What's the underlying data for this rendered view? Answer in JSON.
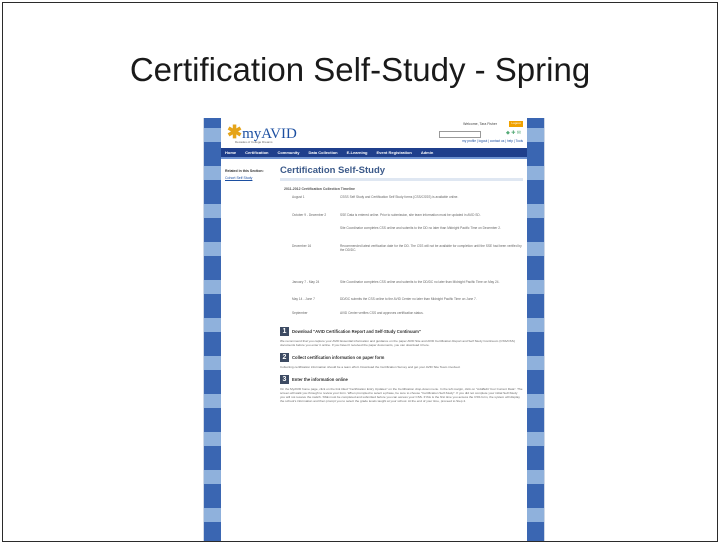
{
  "slide": {
    "title": "Certification Self-Study - Spring"
  },
  "site": {
    "logo_text": "myAVID",
    "logo_sub": "Decades of College Dreams",
    "welcome": "Welcome, Tara Fisher",
    "login_label": "Logout",
    "header_links": "my profile | logout | contact us | help | Tools",
    "nav": [
      "Home",
      "Certification",
      "Community",
      "Data Collection",
      "E-Learning",
      "Event Registration",
      "Admin"
    ]
  },
  "sidebar": {
    "heading": "Related in this Section:",
    "link": "Cohort Self Study"
  },
  "main": {
    "page_title": "Certification Self-Study",
    "timeline_heading": "2011-2012 Certification Collection Timeline",
    "timeline": [
      {
        "date": "August 1",
        "desc": "CSSS Self Study and Certification Self Study forms (CSS/CSSS) is available online."
      },
      {
        "date": "October 9 - December 2",
        "desc": "SSE Data is entered online. Prior to submission, site team information must be updated in AVID SD."
      },
      {
        "date": "",
        "desc": "Site Coordinator completes CSS online and submits to the DD no later than Midnight Pacific Time on December 2."
      },
      {
        "date": "December 16",
        "desc": "Recommended latest verification date for the DD. The CSS will not be available for completion until the SSE had been verified by the DD/DC."
      },
      {
        "date": "January 7 - May 24",
        "desc": "Site Coordinator completes CSS online and submits to the DD/DC no later than Midnight Pacific Time on May 24."
      },
      {
        "date": "May 14 - June 7",
        "desc": "DD/DC submits the CSS online to the AVID Center no later than Midnight Pacific Time on June 7."
      },
      {
        "date": "September",
        "desc": "AVID Center verifies CSS and approves certification status."
      }
    ],
    "steps": [
      {
        "num": "1",
        "title": "Download \"AVID Certification Report and Self-Study Continuum\"",
        "text": "We recommend that you capture your AVID Essential information and guidance on the paper AVID Site and AVID Certification Report and Self Study Continuum (CSS/CSS) documents before you enter it online. If you haven't received the paper documents, you can download it here."
      },
      {
        "num": "2",
        "title": "Collect certification information on paper form",
        "text": "Collecting certification information should be a team effort. Download the Certification Survey and get your AVID Site Team involved."
      },
      {
        "num": "3",
        "title": "Enter the information online",
        "text": "On the MyAVID home page, click on the link titled \"Certification Entry Updates\" on the Certification drop-down menu. In the left margin, click on \"Add/Edit Your Current Data\". The screen will walk you through to review your form. When prompted to select a phase, be sure to choose \"Certification Self-Study\". If you did not complete your initial Self-Study you will not receive the switch. SSE must be completed and submitted before you can access your CSS. If this is the first time you access the CSS form, the system will display the school's information and then prompt you to select the grade levels taught at your school. At the end of your time, proceed to Step 4."
      }
    ]
  }
}
